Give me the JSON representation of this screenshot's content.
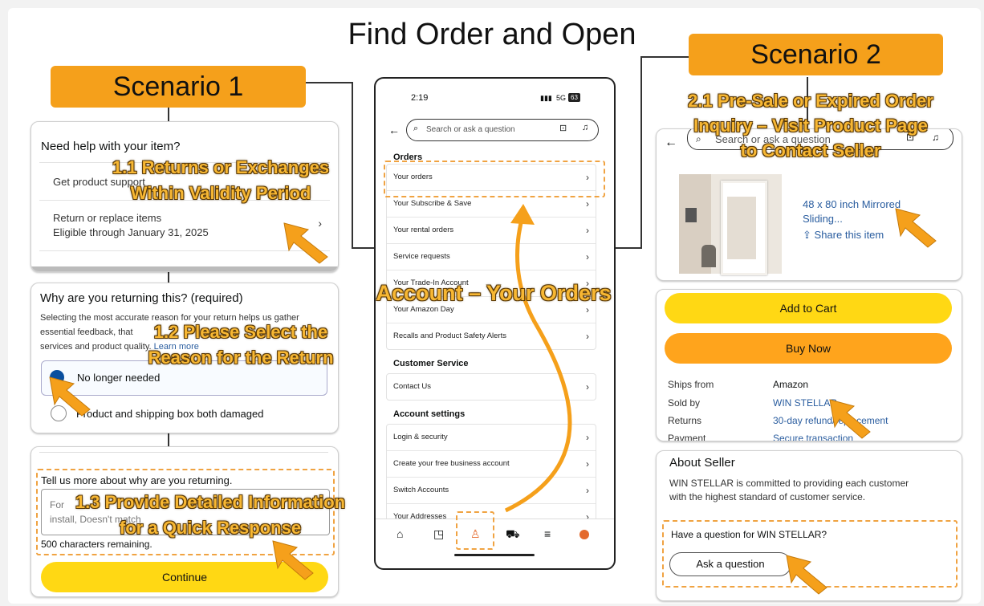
{
  "title": "Find Order and Open",
  "scenario1": {
    "label": "Scenario 1",
    "card1": {
      "heading": "Need help with your item?",
      "item1": "Get product support",
      "item2": "Return or replace items",
      "item2_sub": "Eligible through January 31, 2025"
    },
    "callout1": "1.1 Returns or Exchanges\nWithin Validity Period",
    "card2": {
      "heading": "Why are you returning this? (required)",
      "desc_1": "Selecting the most accurate reason for your return helps us gather",
      "desc_2": "essential feedback, that",
      "desc_3": "services and product quality.",
      "learn_more": "Learn more",
      "option1": "No longer needed",
      "option2": "Product and shipping box both damaged"
    },
    "callout2": "1.2 Please Select the\nReason for the Return",
    "card3": {
      "heading": "Tell us more about why are you returning.",
      "text_1": "For",
      "text_2": "install, Doesn't match",
      "chars_remaining": "500 characters remaining.",
      "continue": "Continue"
    },
    "callout3": "1.3 Provide Detailed Information\nfor a Quick Response"
  },
  "phone": {
    "time": "2:19",
    "network": "5G",
    "battery": "63",
    "search_placeholder": "Search or ask a question",
    "orders_heading": "Orders",
    "orders": [
      "Your orders",
      "Your Subscribe & Save",
      "Your rental orders",
      "Service requests",
      "Your Trade-In Account",
      "Your Amazon Day",
      "Recalls and Product Safety Alerts"
    ],
    "customer_service_heading": "Customer Service",
    "customer_service": [
      "Contact Us"
    ],
    "account_settings_heading": "Account settings",
    "account_settings": [
      "Login & security",
      "Create your free business account",
      "Switch Accounts",
      "Your Addresses"
    ],
    "callout": "Account – Your Orders",
    "nav_icons": [
      "home-icon",
      "library-icon",
      "account-icon",
      "cart-icon",
      "menu-icon",
      "ai-assistant-icon"
    ]
  },
  "scenario2": {
    "label": "Scenario 2",
    "callout": "2.1 Pre-Sale or Expired Order\nInquiry – Visit Product Page\nto Contact Seller",
    "search_placeholder": "Search or ask a question",
    "product_title_1": "48 x 80 inch Mirrored",
    "product_title_2": "Sliding...",
    "share": "Share this item",
    "add_to_cart": "Add to Cart",
    "buy_now": "Buy Now",
    "details": [
      {
        "label": "Ships from",
        "value": "Amazon"
      },
      {
        "label": "Sold by",
        "value": "WIN STELLAR"
      },
      {
        "label": "Returns",
        "value": "30-day refund/replacement"
      },
      {
        "label": "Payment",
        "value": "Secure transaction"
      }
    ],
    "about_heading": "About Seller",
    "about_text_1": "WIN STELLAR is committed to providing each customer",
    "about_text_2": "with the highest standard of customer service.",
    "question_heading": "Have a question for WIN STELLAR?",
    "ask_button": "Ask a question"
  },
  "colors": {
    "accent_orange": "#f5a01b",
    "callout_yellow": "#f7b733",
    "add_to_cart": "#ffd814",
    "buy_now": "#ffa41c",
    "link": "#2a5d9f"
  }
}
